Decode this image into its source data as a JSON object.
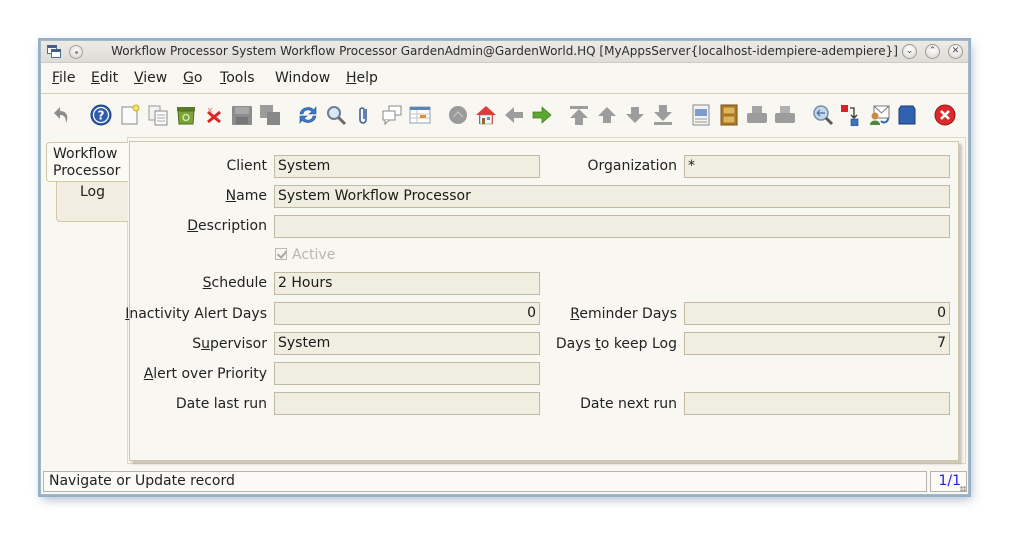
{
  "window": {
    "title": "Workflow Processor  System Workflow Processor  GardenAdmin@GardenWorld.HQ [MyAppsServer{localhost-idempiere-adempiere}]",
    "controls": [
      "minimize",
      "maximize",
      "close"
    ]
  },
  "menu": [
    {
      "label": "File",
      "mnemonic": "F"
    },
    {
      "label": "Edit",
      "mnemonic": "E"
    },
    {
      "label": "View",
      "mnemonic": "V"
    },
    {
      "label": "Go",
      "mnemonic": "G"
    },
    {
      "label": "Tools",
      "mnemonic": "T"
    },
    {
      "label": "Window",
      "mnemonic": ""
    },
    {
      "label": "Help",
      "mnemonic": "H"
    }
  ],
  "toolbar": [
    {
      "name": "undo-icon",
      "enabled": false
    },
    {
      "name": "help-icon",
      "enabled": true
    },
    {
      "name": "new-record-icon",
      "enabled": true
    },
    {
      "name": "copy-record-icon",
      "enabled": true
    },
    {
      "name": "delete-icon",
      "enabled": true
    },
    {
      "name": "delete-selection-icon",
      "enabled": true
    },
    {
      "name": "save-icon",
      "enabled": false
    },
    {
      "name": "save-and-new-icon",
      "enabled": false
    },
    {
      "name": "refresh-icon",
      "enabled": true
    },
    {
      "name": "find-icon",
      "enabled": true
    },
    {
      "name": "attachment-icon",
      "enabled": true
    },
    {
      "name": "chat-icon",
      "enabled": true
    },
    {
      "name": "grid-toggle-icon",
      "enabled": true
    },
    {
      "name": "history-icon",
      "enabled": false
    },
    {
      "name": "home-icon",
      "enabled": true
    },
    {
      "name": "parent-record-icon",
      "enabled": false
    },
    {
      "name": "detail-record-icon",
      "enabled": true
    },
    {
      "name": "first-record-icon",
      "enabled": false
    },
    {
      "name": "previous-record-icon",
      "enabled": false
    },
    {
      "name": "next-record-icon",
      "enabled": false
    },
    {
      "name": "last-record-icon",
      "enabled": false
    },
    {
      "name": "report-icon",
      "enabled": true
    },
    {
      "name": "archive-icon",
      "enabled": true
    },
    {
      "name": "print-preview-icon",
      "enabled": false
    },
    {
      "name": "print-icon",
      "enabled": false
    },
    {
      "name": "zoom-across-icon",
      "enabled": true
    },
    {
      "name": "active-workflows-icon",
      "enabled": true
    },
    {
      "name": "request-icon",
      "enabled": true
    },
    {
      "name": "product-info-icon",
      "enabled": true
    },
    {
      "name": "exit-icon",
      "enabled": true
    }
  ],
  "tabs": [
    {
      "label_line1": "Workflow",
      "label_line2": "Processor",
      "active": true
    },
    {
      "label_line1": "Log",
      "active": false
    }
  ],
  "form": {
    "client": {
      "label": "Client",
      "value": "System"
    },
    "organization": {
      "label": "Organization",
      "value": "*"
    },
    "name": {
      "label_pre": "",
      "label_mn": "N",
      "label_post": "ame",
      "value": "System Workflow Processor"
    },
    "description": {
      "label_pre": "",
      "label_mn": "D",
      "label_post": "escription",
      "value": ""
    },
    "active": {
      "label": "Active",
      "checked": true,
      "enabled": false
    },
    "schedule": {
      "label_pre": "",
      "label_mn": "S",
      "label_post": "chedule",
      "value": "2 Hours"
    },
    "inactivity_alert_days": {
      "label_pre": "",
      "label_mn": "I",
      "label_post": "nactivity Alert Days",
      "value": "0"
    },
    "reminder_days": {
      "label_pre": "",
      "label_mn": "R",
      "label_post": "eminder Days",
      "value": "0"
    },
    "supervisor": {
      "label_pre": "S",
      "label_mn": "u",
      "label_post": "pervisor",
      "value": "System"
    },
    "days_to_keep_log": {
      "label_pre": "Days ",
      "label_mn": "t",
      "label_post": "o keep Log",
      "value": "7"
    },
    "alert_over_priority": {
      "label_pre": "",
      "label_mn": "A",
      "label_post": "lert over Priority",
      "value": ""
    },
    "date_last_run": {
      "label": "Date last run",
      "value": ""
    },
    "date_next_run": {
      "label": "Date next run",
      "value": ""
    }
  },
  "status": {
    "message": "Navigate or Update record",
    "record": "1/1"
  }
}
